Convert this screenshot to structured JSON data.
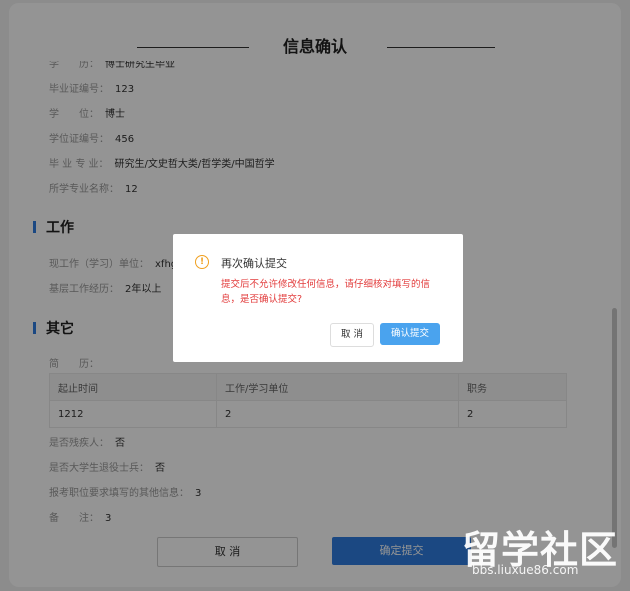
{
  "dialog_title": "信息确认",
  "education": [
    {
      "label": "学　　历：",
      "value": "博士研究生毕业"
    },
    {
      "label": "毕业证编号：",
      "value": "123"
    },
    {
      "label": "学　　位：",
      "value": "博士"
    },
    {
      "label": "学位证编号：",
      "value": "456"
    },
    {
      "label": "毕 业 专 业：",
      "value": "研究生/文史哲大类/哲学类/中国哲学"
    },
    {
      "label": "所学专业名称：",
      "value": "12"
    }
  ],
  "work": {
    "heading": "工作",
    "current_unit_label": "现工作（学习）单位：",
    "current_unit_value": "xfhg",
    "grassroots_label": "基层工作经历：",
    "grassroots_value": "2年以上"
  },
  "other": {
    "heading": "其它",
    "resume_label": "简　　历：",
    "table_headers": [
      "起止时间",
      "工作/学习单位",
      "职务"
    ],
    "table_rows": [
      [
        "1212",
        "2",
        "2"
      ]
    ],
    "disabled_label": "是否残疾人：",
    "disabled_value": "否",
    "veteran_label": "是否大学生退役士兵：",
    "veteran_value": "否",
    "other_info_label": "报考职位要求填写的其他信息：",
    "other_info_value": "3",
    "remark_label": "备　　注：",
    "remark_value": "3"
  },
  "footer": {
    "cancel": "取 消",
    "confirm": "确定提交"
  },
  "confirm_modal": {
    "title": "再次确认提交",
    "message": "提交后不允许修改任何信息，请仔细核对填写的信息，是否确认提交?",
    "cancel": "取 消",
    "ok": "确认提交"
  },
  "watermark": {
    "brand": "留学社区",
    "url": "bbs.liuxue86.com"
  },
  "colors": {
    "primary": "#2f7de1",
    "modal_ok": "#4aa3ee",
    "warning": "#f0a020",
    "danger": "#e23b3b"
  }
}
